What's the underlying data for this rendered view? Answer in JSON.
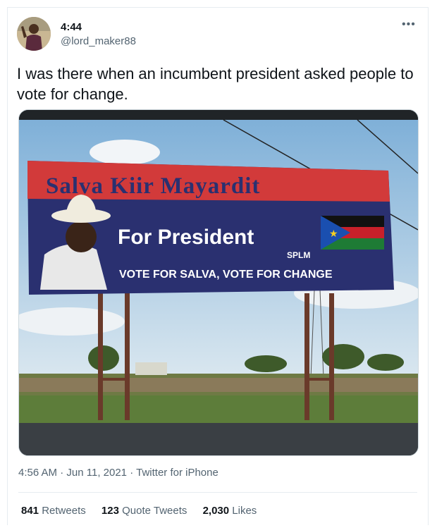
{
  "tweet": {
    "display_name": "4:44",
    "handle": "@lord_maker88",
    "more_icon": "more-dots-icon",
    "text": "I was there when an incumbent president asked people to vote for change.",
    "time": "4:56 AM",
    "date": "Jun 11, 2021",
    "source": "Twitter for iPhone",
    "sep": "·"
  },
  "billboard": {
    "name": "Salva Kiir Mayardit",
    "headline": "For President",
    "party": "SPLM",
    "slogan": "VOTE FOR SALVA, VOTE FOR CHANGE"
  },
  "stats": {
    "retweets_count": "841",
    "retweets_label": "Retweets",
    "quotes_count": "123",
    "quotes_label": "Quote Tweets",
    "likes_count": "2,030",
    "likes_label": "Likes"
  },
  "colors": {
    "sky": "#8fb8d8",
    "billboard_blue": "#2a3070",
    "billboard_red": "#d23a3a",
    "grass": "#5d7d3a"
  }
}
